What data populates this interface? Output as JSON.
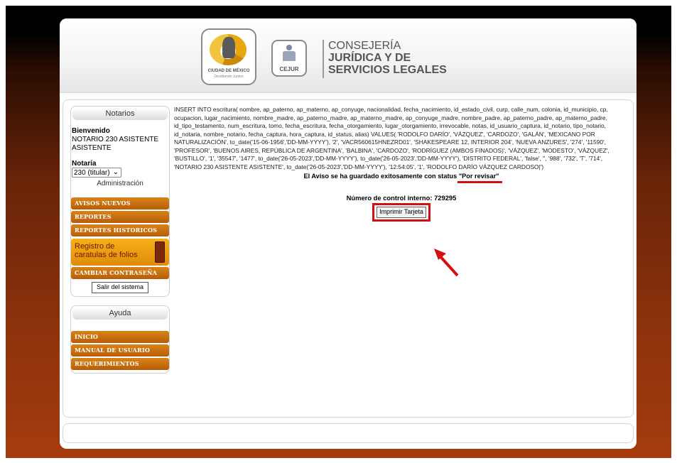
{
  "brand": {
    "cdmx_caption": "CIUDAD DE MÉXICO",
    "cdmx_subcaption": "Decidiendo Juntos",
    "cejur_label": "CEJUR",
    "line1": "CONSEJERÍA",
    "line2": "JURÍDICA Y DE",
    "line3": "SERVICIOS LEGALES"
  },
  "sidebar": {
    "notarios_title": "Notarios",
    "welcome_label": "Bienvenido",
    "user_name": "NOTARIO 230 ASISTENTE ASISTENTE",
    "notaria_label": "Notaría",
    "notaria_value": "230 (titular)",
    "admin_label": "Administración",
    "menu": {
      "avisos": "AVISOS NUEVOS",
      "reportes": "REPORTES",
      "historicos": "REPORTES HISTORICOS",
      "folios_line1": "Registro de",
      "folios_line2": "caratulas de folios",
      "password": "CAMBIAR CONTRASEÑA"
    },
    "logout": "Salir del sistema",
    "help_title": "Ayuda",
    "help": {
      "inicio": "INICIO",
      "manual": "MANUAL DE USUARIO",
      "requerimientos": "REQUERIMIENTOS"
    }
  },
  "main": {
    "sql": "INSERT INTO escritura( nombre, ap_paterno, ap_materno, ap_conyuge, nacionalidad, fecha_nacimiento, id_estado_civil, curp, calle_num, colonia, id_municipio, cp, ocupacion, lugar_nacimiento, nombre_madre, ap_paterno_madre, ap_materno_madre, ap_conyuge_madre, nombre_padre, ap_paterno_padre, ap_materno_padre, id_tipo_testamento, num_escritura, tomo, fecha_escritura, fecha_otorgamiento, lugar_otorgamiento, irrevocable, notas, id_usuario_captura, id_notario, tipo_notario, id_notaria, nombre_notario, fecha_captura, hora_captura, id_status, alias) VALUES( 'RODOLFO DARÍO', 'VÁZQUEZ', 'CARDOZO', 'GALÁN', 'MEXICANO POR NATURALIZACIÓN', to_date('15-06-1956','DD-MM-YYYY'), '2', 'VACR560615HNEZRD01', 'SHAKESPEARE 12, INTERIOR 204', 'NUEVA ANZURES', '274', '11590', 'PROFESOR', 'BUENOS AIRES, REPÚBLICA DE ARGENTINA', 'BALBINA', 'CARDOZO', 'RODRÍGUEZ (AMBOS FINADOS)', 'VÁZQUEZ', 'MODESTO', 'VÁZQUEZ', 'BUSTILLO', '1', '35547', '1477', to_date('26-05-2023','DD-MM-YYYY'), to_date('26-05-2023','DD-MM-YYYY'), 'DISTRITO FEDERAL', 'false', '', '988', '732', 'T', '714', 'NOTARIO 230 ASISTENTE ASISTENTE', to_date('26-05-2023','DD-MM-YYYY'), '12:54:05', '1', 'RODOLFO DARÍO VÁZQUEZ CARDOSO|')",
    "saved_prefix": "El Aviso se ha guardado exitosamente con status ",
    "saved_status": "\"Por revisar\"",
    "control_label": "Número de control interno: 729295",
    "print_button": "Imprimir Tarjeta"
  },
  "colors": {
    "menu_orange": "#c86c0f",
    "highlight_red": "#d21010"
  }
}
